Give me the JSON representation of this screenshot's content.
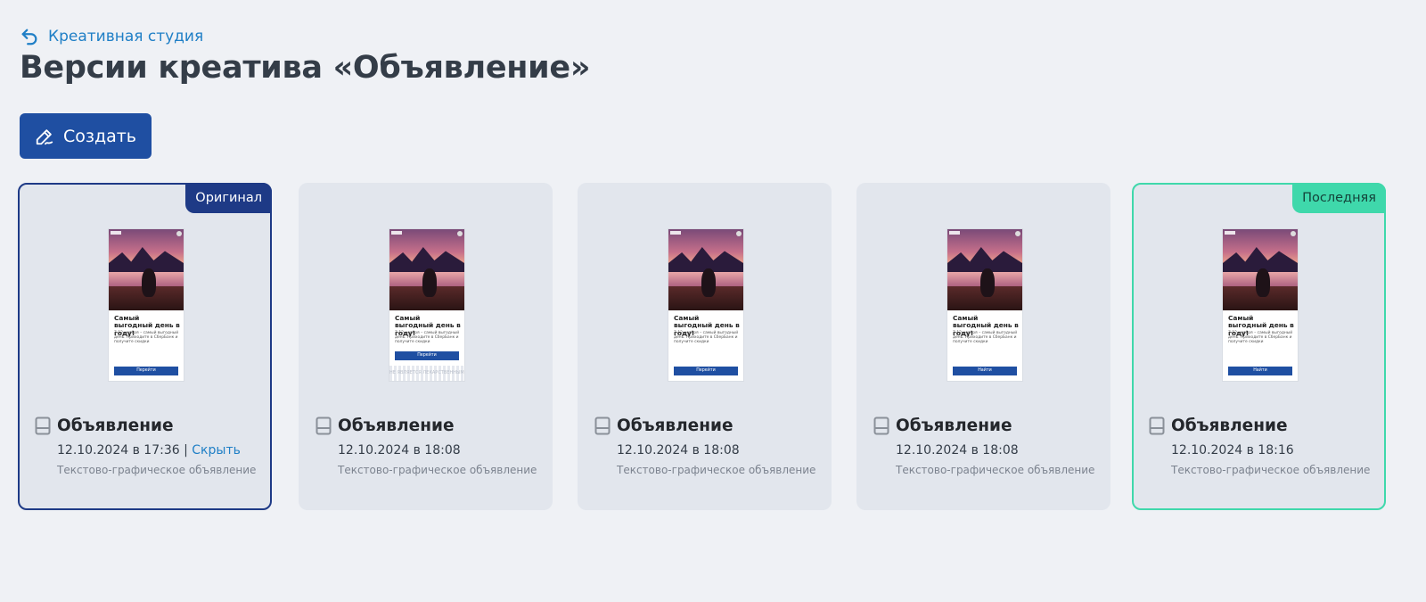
{
  "back": {
    "label": "Креативная студия",
    "icon": "undo-arrow-icon"
  },
  "page": {
    "title": "Версии креатива «Объявление»"
  },
  "toolbar": {
    "create_label": "Создать",
    "create_icon": "pen-edit-icon"
  },
  "cards": [
    {
      "badge": "Оригинал",
      "name": "Объявление",
      "date": "12.10.2024 в 17:36",
      "separator": "|",
      "hide_label": "Скрыть",
      "type": "Текстово-графическое объявление",
      "preview": {
        "heading": "Самый выгодный день в году!",
        "text": "7-12 ноября – самый выгодный день. Приходите в СберБанк и получите скидки",
        "button": "Перейти"
      }
    },
    {
      "name": "Объявление",
      "date": "12.10.2024 в 18:08",
      "type": "Текстово-графическое объявление",
      "preview": {
        "heading": "Самый выгодный день в году!",
        "text": "7-12 ноября – самый выгодный день. Приходите в СберБанк и получите скидки",
        "button": "Перейти",
        "legal": "НЕ ЯВЛЯЕТСЯ ЛЕКАРСТВЕННЫМ СРЕДСТВОМ"
      }
    },
    {
      "name": "Объявление",
      "date": "12.10.2024 в 18:08",
      "type": "Текстово-графическое объявление",
      "preview": {
        "heading": "Самый выгодный день в году!",
        "text": "7-12 ноября – самый выгодный день. Приходите в СберБанк и получите скидки",
        "button": "Перейти"
      }
    },
    {
      "name": "Объявление",
      "date": "12.10.2024 в 18:08",
      "type": "Текстово-графическое объявление",
      "preview": {
        "heading": "Самый выгодный день в году!",
        "text": "7-12 ноября – самый выгодный день. Приходите в СберБанк и получите скидки",
        "button": "Найти"
      }
    },
    {
      "badge": "Последняя",
      "name": "Объявление",
      "date": "12.10.2024 в 18:16",
      "type": "Текстово-графическое объявление",
      "preview": {
        "heading": "Самый выгодный день в году!",
        "text": "7-12 ноября – самый выгодный день. Приходите в СберБанк и получите скидки",
        "button": "Найти"
      }
    }
  ],
  "colors": {
    "background": "#eff1f5",
    "card": "#e2e6ed",
    "primary": "#1f4fa2",
    "original_border": "#1e3a86",
    "latest_border": "#3fd8ab",
    "link": "#1f7fc6",
    "title": "#343d48"
  }
}
